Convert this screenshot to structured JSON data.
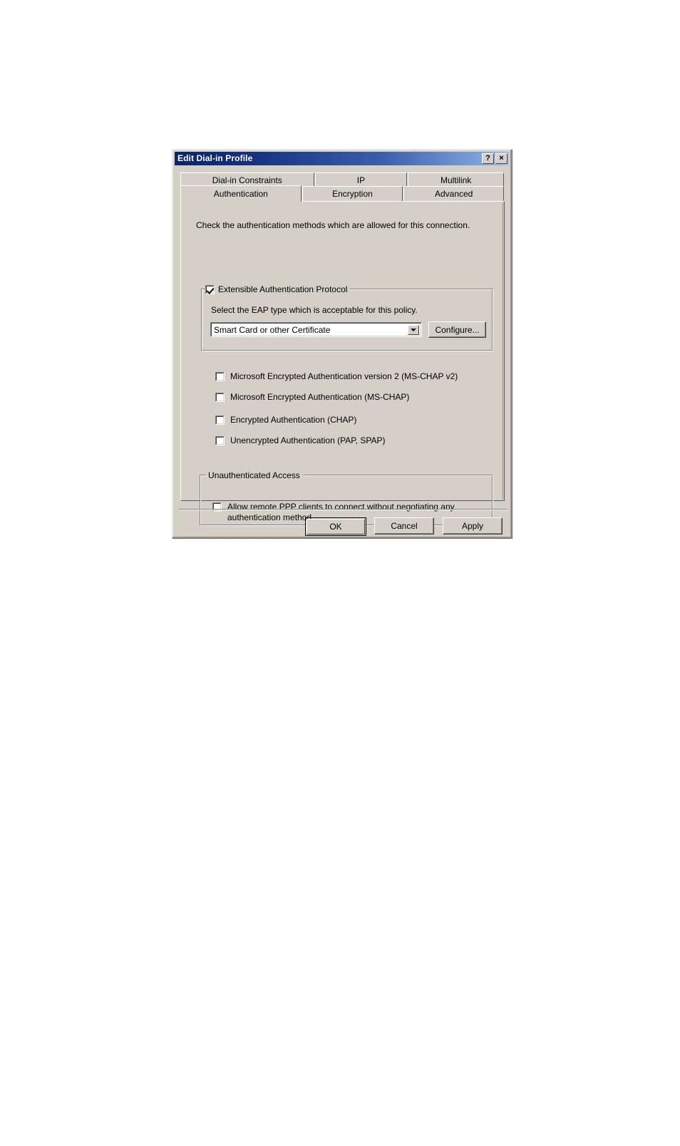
{
  "dialog": {
    "title": "Edit Dial-in Profile",
    "titlebar_buttons": [
      {
        "name": "help-button",
        "glyph": "?"
      },
      {
        "name": "close-button",
        "glyph": "×"
      }
    ]
  },
  "tabs": {
    "row1": [
      {
        "label": "Dial-in Constraints",
        "active": false
      },
      {
        "label": "IP",
        "active": false
      },
      {
        "label": "Multilink",
        "active": false
      }
    ],
    "row2": [
      {
        "label": "Authentication",
        "active": true
      },
      {
        "label": "Encryption",
        "active": false
      },
      {
        "label": "Advanced",
        "active": false
      }
    ]
  },
  "panel": {
    "intro": "Check the authentication methods which are allowed for this connection.",
    "eap_group": {
      "legend": "Extensible Authentication Protocol",
      "checked": true,
      "description": "Select the EAP type which is acceptable for this policy.",
      "combo_value": "Smart Card or other Certificate",
      "configure_label": "Configure..."
    },
    "methods": [
      {
        "label": "Microsoft Encrypted Authentication version 2 (MS-CHAP v2)",
        "checked": false
      },
      {
        "label": "Microsoft Encrypted Authentication (MS-CHAP)",
        "checked": false
      },
      {
        "label": "Encrypted Authentication (CHAP)",
        "checked": false
      },
      {
        "label": "Unencrypted Authentication (PAP, SPAP)",
        "checked": false
      }
    ],
    "unauth_group": {
      "legend": "Unauthenticated Access",
      "checkbox_label": "Allow remote PPP clients to connect without negotiating any authentication method.",
      "checked": false
    }
  },
  "footer": {
    "ok_label": "OK",
    "cancel_label": "Cancel",
    "apply_label": "Apply"
  },
  "colors": {
    "face": "#d4d0c8",
    "title_start": "#0a246a",
    "title_end": "#a6c0e8",
    "page_background": "#ffffff"
  }
}
